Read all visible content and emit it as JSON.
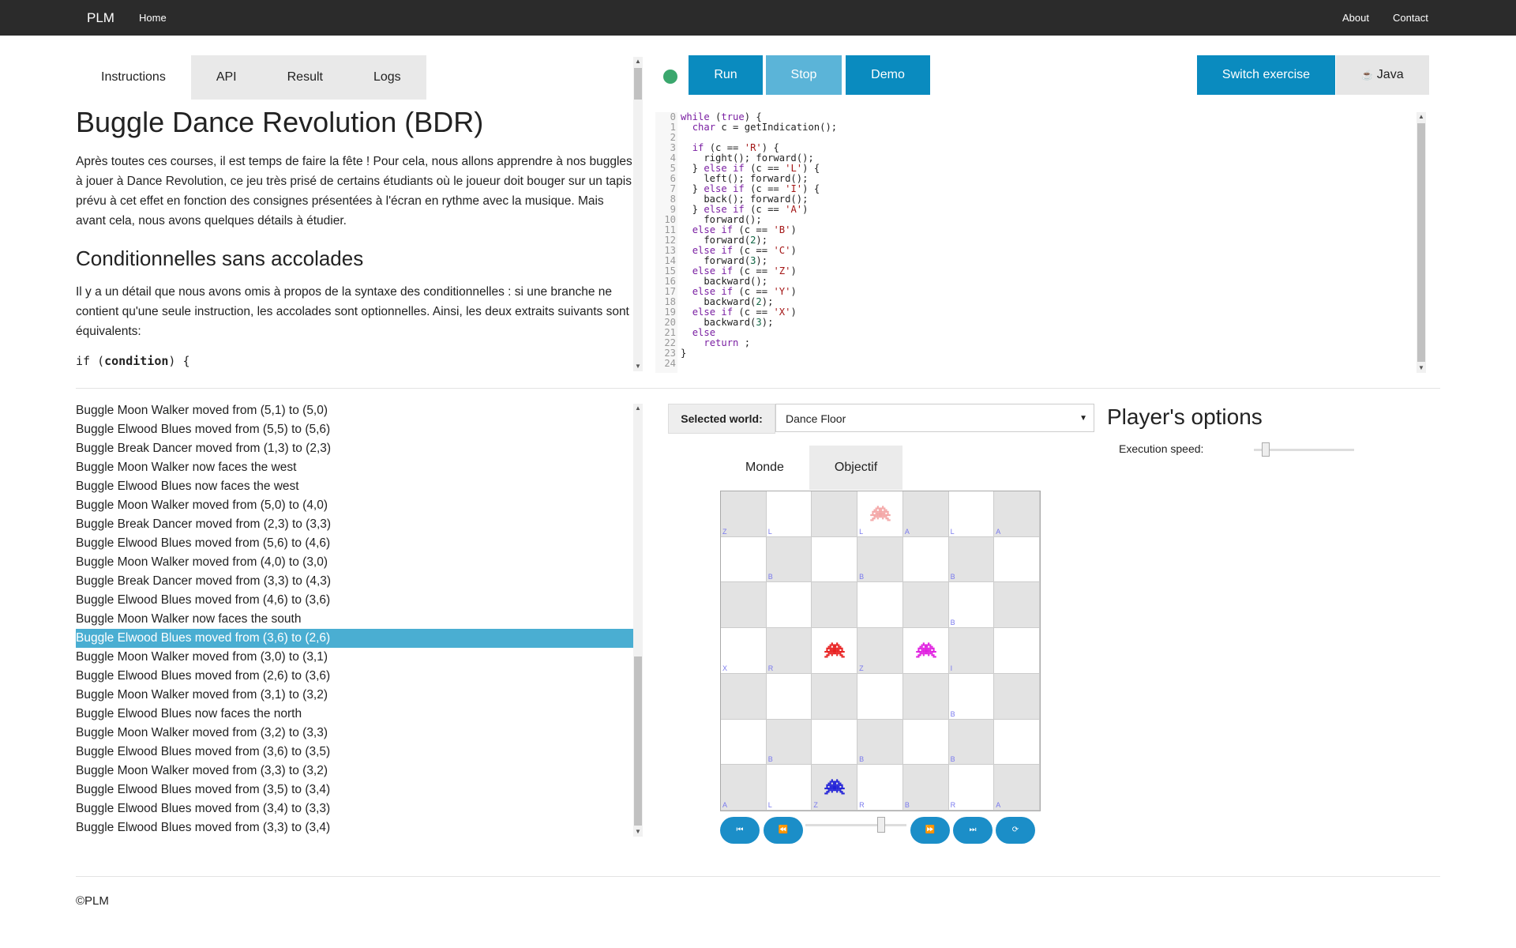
{
  "navbar": {
    "brand": "PLM",
    "home": "Home",
    "about": "About",
    "contact": "Contact"
  },
  "tabs": [
    {
      "label": "Instructions",
      "active": true
    },
    {
      "label": "API",
      "active": false
    },
    {
      "label": "Result",
      "active": false
    },
    {
      "label": "Logs",
      "active": false
    }
  ],
  "instructions": {
    "title": "Buggle Dance Revolution (BDR)",
    "intro": "Après toutes ces courses, il est temps de faire la fête ! Pour cela, nous allons apprendre à nos buggles à jouer à Dance Revolution, ce jeu très prisé de certains étudiants où le joueur doit bouger sur un tapis prévu à cet effet en fonction des consignes présentées à l'écran en rythme avec la musique. Mais avant cela, nous avons quelques détails à étudier.",
    "subtitle": "Conditionnelles sans accolades",
    "body": "Il y a un détail que nous avons omis à propos de la syntaxe des conditionnelles : si une branche ne contient qu'une seule instruction, les accolades sont optionnelles. Ainsi, les deux extraits suivants sont équivalents:",
    "code_prefix": "if (",
    "code_bold": "condition",
    "code_suffix": ") {"
  },
  "toolbar": {
    "status_color": "#3aa76d",
    "run": "Run",
    "stop": "Stop",
    "demo": "Demo",
    "switch": "Switch exercise",
    "language": "Java",
    "colors": {
      "primary": "#0a8bbf",
      "stop": "#5bb4d8",
      "lang_bg": "#e6e6e6"
    }
  },
  "editor": {
    "lines": [
      "while (true) {",
      "  char c = getIndication();",
      "",
      "  if (c == 'R') {",
      "    right(); forward();",
      "  } else if (c == 'L') {",
      "    left(); forward();",
      "  } else if (c == 'I') {",
      "    back(); forward();",
      "  } else if (c == 'A')",
      "    forward();",
      "  else if (c == 'B')",
      "    forward(2);",
      "  else if (c == 'C')",
      "    forward(3);",
      "  else if (c == 'Z')",
      "    backward();",
      "  else if (c == 'Y')",
      "    backward(2);",
      "  else if (c == 'X')",
      "    backward(3);",
      "  else",
      "    return ;",
      "}",
      ""
    ]
  },
  "logs": [
    "Buggle Moon Walker moved from (5,1) to (5,0)",
    "Buggle Elwood Blues moved from (5,5) to (5,6)",
    "Buggle Break Dancer moved from (1,3) to (2,3)",
    "Buggle Moon Walker now faces the west",
    "Buggle Elwood Blues now faces the west",
    "Buggle Moon Walker moved from (5,0) to (4,0)",
    "Buggle Break Dancer moved from (2,3) to (3,3)",
    "Buggle Elwood Blues moved from (5,6) to (4,6)",
    "Buggle Moon Walker moved from (4,0) to (3,0)",
    "Buggle Break Dancer moved from (3,3) to (4,3)",
    "Buggle Elwood Blues moved from (4,6) to (3,6)",
    "Buggle Moon Walker now faces the south",
    "Buggle Elwood Blues moved from (3,6) to (2,6)",
    "Buggle Moon Walker moved from (3,0) to (3,1)",
    "Buggle Elwood Blues moved from (2,6) to (3,6)",
    "Buggle Moon Walker moved from (3,1) to (3,2)",
    "Buggle Elwood Blues now faces the north",
    "Buggle Moon Walker moved from (3,2) to (3,3)",
    "Buggle Elwood Blues moved from (3,6) to (3,5)",
    "Buggle Moon Walker moved from (3,3) to (3,2)",
    "Buggle Elwood Blues moved from (3,5) to (3,4)",
    "Buggle Elwood Blues moved from (3,4) to (3,3)",
    "Buggle Elwood Blues moved from (3,3) to (3,4)"
  ],
  "selected_log_index": 12,
  "world": {
    "select_label": "Selected world:",
    "selected": "Dance Floor",
    "tabs": [
      {
        "label": "Monde",
        "active": false
      },
      {
        "label": "Objectif",
        "active": true
      }
    ],
    "grid_size": 7,
    "cells": [
      [
        "Z",
        "L",
        "",
        "L",
        "A",
        "L",
        "A"
      ],
      [
        "",
        "B",
        "",
        "B",
        "",
        "B",
        ""
      ],
      [
        "",
        "",
        "",
        "",
        "",
        "B",
        ""
      ],
      [
        "X",
        "R",
        "",
        "Z",
        "",
        "I",
        ""
      ],
      [
        "",
        "",
        "",
        "",
        "",
        "B",
        ""
      ],
      [
        "",
        "B",
        "",
        "B",
        "",
        "B",
        ""
      ],
      [
        "A",
        "L",
        "Z",
        "R",
        "B",
        "R",
        "A"
      ]
    ],
    "buggles": [
      {
        "name": "Moon Walker",
        "col": 3,
        "row": 0,
        "color": "#f4a6a6"
      },
      {
        "name": "Break Dancer",
        "col": 2,
        "row": 3,
        "color": "#e81f1f"
      },
      {
        "name": "Elwood Blues",
        "col": 4,
        "row": 3,
        "color": "#e01fe0"
      },
      {
        "name": "Blue",
        "col": 2,
        "row": 6,
        "color": "#2020d8"
      }
    ],
    "colors": {
      "gray_cell": "#e3e3e3",
      "white_cell": "#ffffff",
      "label": "#7a7aee"
    }
  },
  "player_options": {
    "title": "Player's options",
    "speed_label": "Execution speed:",
    "speed_fraction": 0.12
  },
  "step_fraction": 0.75,
  "footer": "©PLM"
}
